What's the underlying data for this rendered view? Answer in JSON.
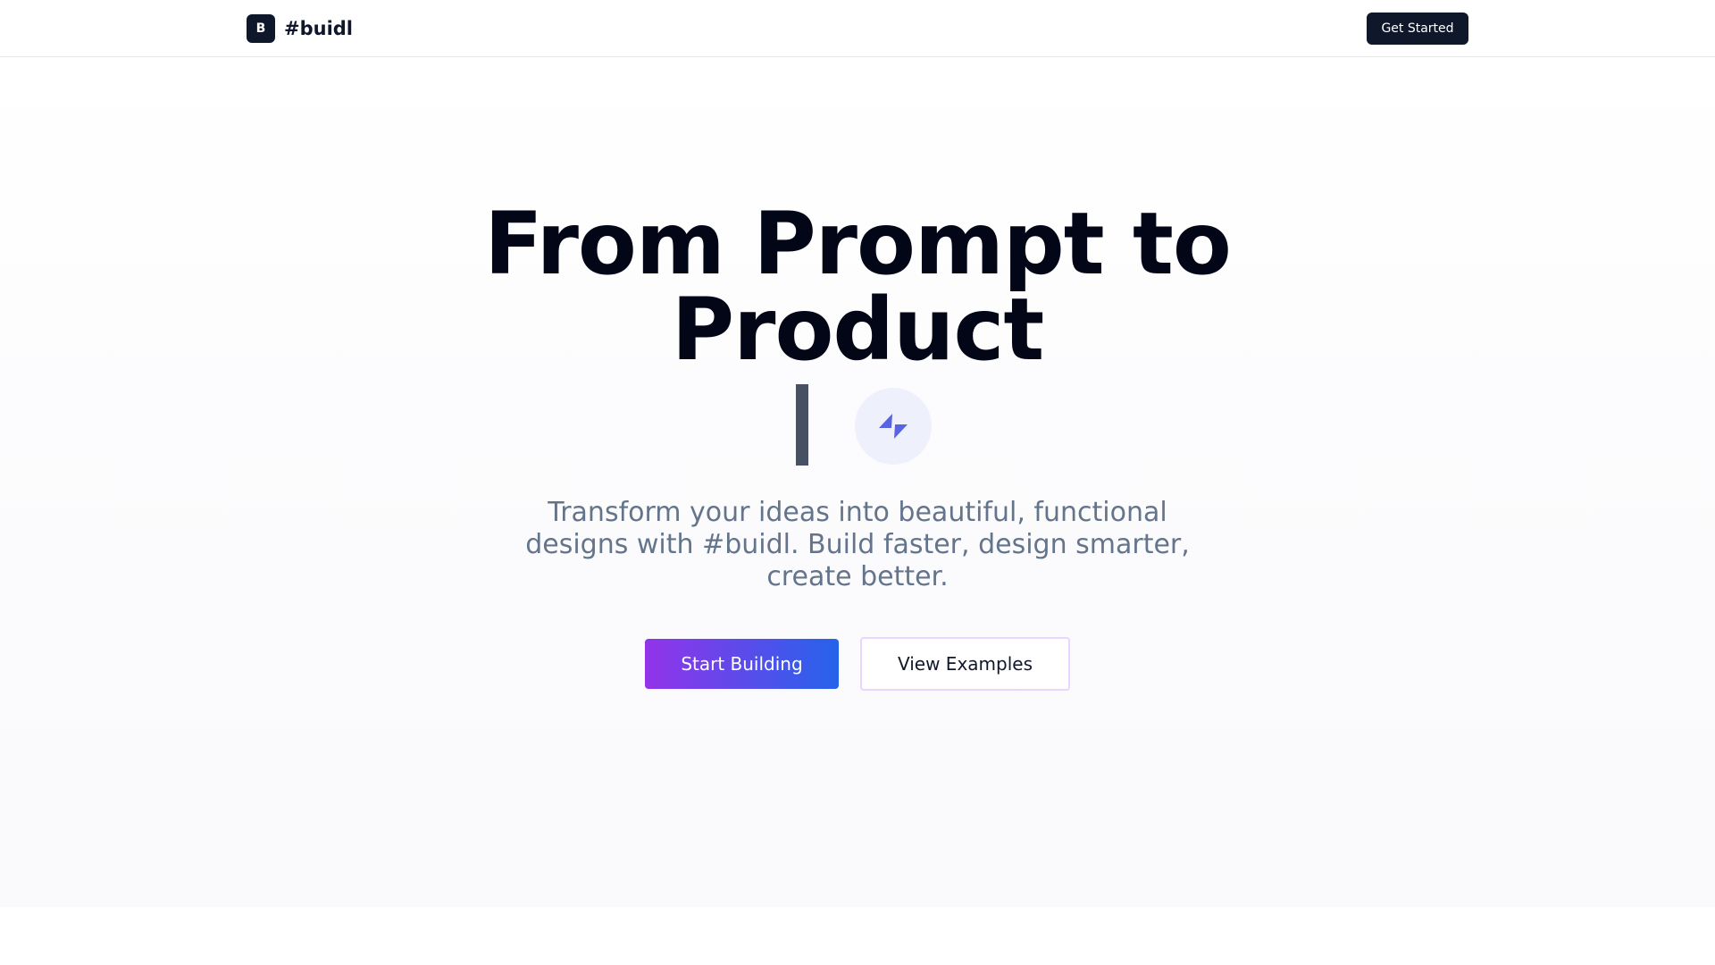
{
  "header": {
    "logo_letter": "B",
    "brand_name": "#buidl",
    "cta_label": "Get Started"
  },
  "hero": {
    "headline_line1": "From Prompt to",
    "headline_line2": "Product",
    "badge_icon": "sparkle-icon",
    "subtitle": "Transform your ideas into beautiful, functional designs with #buidl. Build faster, design smarter, create better.",
    "primary_button": "Start Building",
    "secondary_button": "View Examples"
  },
  "colors": {
    "dark": "#0f172a",
    "gradient_start": "#9333ea",
    "gradient_end": "#2563eb",
    "accent_icon": "#5b64e0",
    "muted_text": "#64748b"
  }
}
